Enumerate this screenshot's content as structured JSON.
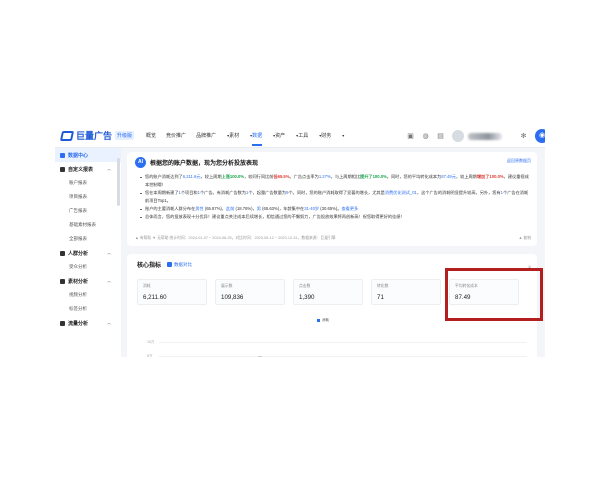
{
  "topbar": {
    "logo_text": "巨量广告",
    "logo_tag": "升级版",
    "nav": [
      "概览",
      "竞价推广",
      "品牌推广",
      "素材",
      "数据",
      "资产",
      "工具",
      "财务"
    ],
    "nav_suffix": "▾",
    "active_index": 4
  },
  "sidebar": {
    "home": "数据中心",
    "sections": [
      {
        "title": "自定义报表",
        "items": [
          "账户报表",
          "项目报表",
          "广告报表",
          "基础素材报表",
          "全部报表"
        ]
      },
      {
        "title": "人群分析",
        "items": [
          "受众分析"
        ]
      },
      {
        "title": "素材分析",
        "items": [
          "视频分析",
          "标签分析"
        ]
      },
      {
        "title": "流量分析",
        "items": []
      }
    ]
  },
  "announcement": {
    "badge": "AI",
    "title": "根据您的账户数据，现为您分析投放表现",
    "link": "返回原数据页",
    "bullets": [
      {
        "parts": [
          {
            "t": "您的账户消耗达到了",
            "c": ""
          },
          {
            "t": "6,211.6元",
            "c": "b"
          },
          {
            "t": "，较上周期",
            "c": ""
          },
          {
            "t": "上涨100.0%",
            "c": "g"
          },
          {
            "t": "，较同行同比前",
            "c": ""
          },
          {
            "t": "低65.5%",
            "c": "r"
          },
          {
            "t": "。广告点击率为",
            "c": ""
          },
          {
            "t": "1.27%",
            "c": "b"
          },
          {
            "t": "，与上周期相比",
            "c": ""
          },
          {
            "t": "提升了100.0%",
            "c": "g"
          },
          {
            "t": "。同时，您的平均转化成本为",
            "c": ""
          },
          {
            "t": "87.49元",
            "c": "b"
          },
          {
            "t": "，较上周期",
            "c": ""
          },
          {
            "t": "增加了100.0%",
            "c": "r"
          },
          {
            "t": "，建议重视成本控制哦!",
            "c": ""
          }
        ]
      },
      {
        "parts": [
          {
            "t": "您在本周期新建了",
            "c": ""
          },
          {
            "t": "1",
            "c": "b"
          },
          {
            "t": "个项目和",
            "c": ""
          },
          {
            "t": "1",
            "c": "b"
          },
          {
            "t": "个广告。有消耗广告数为",
            "c": ""
          },
          {
            "t": "1",
            "c": "b"
          },
          {
            "t": "个，起量广告数量为",
            "c": ""
          },
          {
            "t": "9",
            "c": "b"
          },
          {
            "t": "个。同时，您的账户消耗取得了显著的增长，尤其是",
            "c": ""
          },
          {
            "t": "消费优化测试_01",
            "c": "b"
          },
          {
            "t": "，这个广告的消耗明显提升较高，另外，您有",
            "c": ""
          },
          {
            "t": "1",
            "c": "b"
          },
          {
            "t": "个广告在消耗前项目Top1。",
            "c": ""
          }
        ]
      },
      {
        "parts": [
          {
            "t": "账户的主要消耗人群分布在",
            "c": ""
          },
          {
            "t": "男性",
            "c": "b"
          },
          {
            "t": " (65.87%)，",
            "c": ""
          },
          {
            "t": "此前",
            "c": "b"
          },
          {
            "t": " (18.76%)，",
            "c": ""
          },
          {
            "t": "男",
            "c": "b"
          },
          {
            "t": " (65.63%)，年龄集中在",
            "c": ""
          },
          {
            "t": "31-40岁",
            "c": "b"
          },
          {
            "t": " (30.65%)。",
            "c": ""
          },
          {
            "t": "查看更多",
            "c": "b"
          }
        ]
      },
      {
        "parts": [
          {
            "t": "总体而言，您的投放表现十分优异！建议重点关注成本后续增长，相信通过您的不懈努力，广告投放效果将再创新高！祝您取得更好的佳绩！",
            "c": ""
          }
        ]
      }
    ],
    "footer": "▲ 有帮助   ▼ 无帮助   统计时间：2024-01-07 ~ 2024-06-25，对比时间：2023-06-12 ~ 2023-12-31，数据来源：巨量引擎",
    "footer_right": "▲ 复制"
  },
  "metrics": {
    "title": "核心指标",
    "check_label": "数据对比",
    "corner": "⇲",
    "kpis": [
      {
        "label": "消耗",
        "value": "6,211.60"
      },
      {
        "label": "展示数",
        "value": "109,836"
      },
      {
        "label": "点击数",
        "value": "1,390"
      },
      {
        "label": "转化数",
        "value": "71"
      },
      {
        "label": "平均转化成本",
        "value": "87.49"
      }
    ],
    "legend": "消耗",
    "y_ticks": [
      "16万",
      "8万"
    ]
  },
  "colors": {
    "accent": "#2b6ef2",
    "highlight": "#b31f1f",
    "up": "#17a34a",
    "down": "#e03c31"
  }
}
